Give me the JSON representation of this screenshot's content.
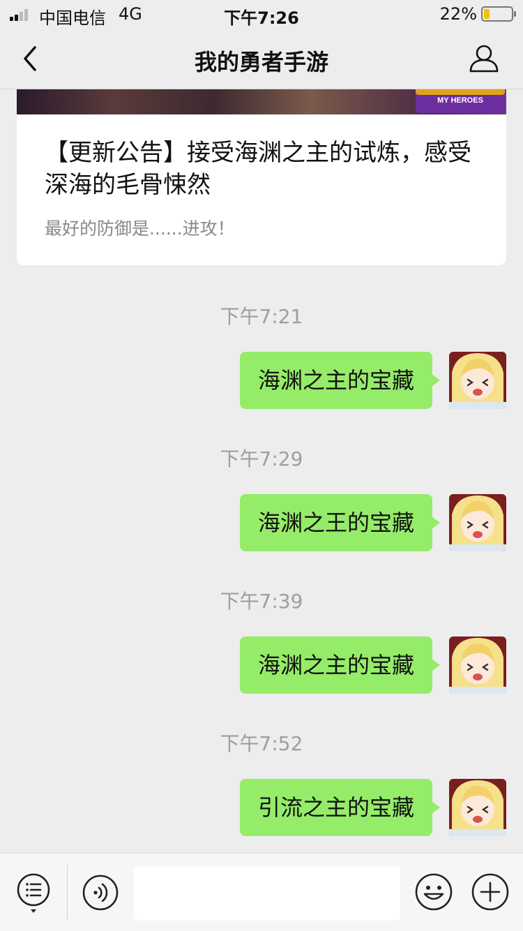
{
  "status_bar": {
    "carrier": "中国电信",
    "network": "4G",
    "time": "下午7:26",
    "battery_percent_label": "22%",
    "battery_level": 0.22,
    "battery_color": "#f2c200"
  },
  "nav": {
    "title": "我的勇者手游",
    "back_icon": "chevron-left-icon",
    "profile_icon": "person-icon"
  },
  "article": {
    "banner_logo_text": "MY HEROES",
    "title": "【更新公告】接受海渊之主的试炼，感受深海的毛骨悚然",
    "summary": "最好的防御是......进攻！"
  },
  "messages": [
    {
      "time": "下午7:21",
      "text": "海渊之主的宝藏"
    },
    {
      "time": "下午7:29",
      "text": "海渊之王的宝藏"
    },
    {
      "time": "下午7:39",
      "text": "海渊之主的宝藏"
    },
    {
      "time": "下午7:52",
      "text": "引流之主的宝藏"
    }
  ],
  "colors": {
    "background": "#ededed",
    "bubble": "#95ec69",
    "timestamp": "#9e9e9e"
  },
  "input_bar": {
    "menu_icon": "menu-list-icon",
    "voice_icon": "voice-icon",
    "input_value": "",
    "emoji_icon": "emoji-icon",
    "plus_icon": "plus-icon"
  }
}
